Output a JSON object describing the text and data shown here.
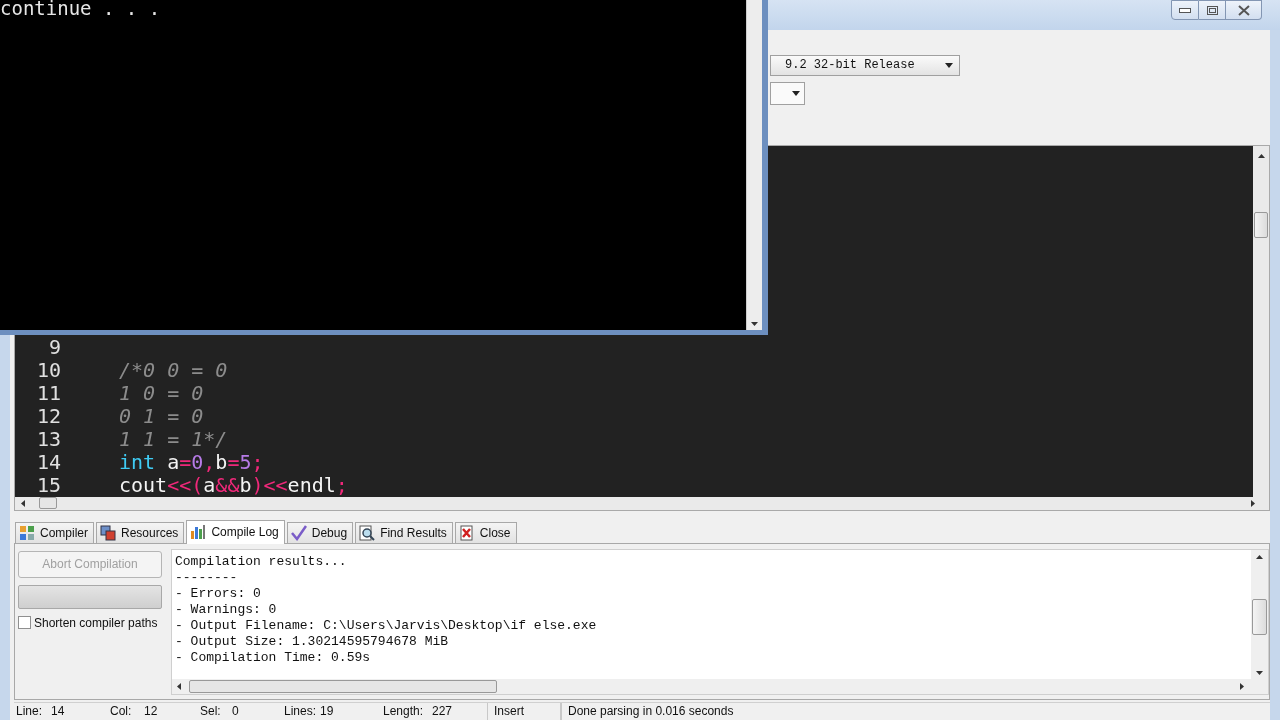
{
  "console": {
    "lines": [
      "continue . . ."
    ]
  },
  "toolbar": {
    "compiler_select": {
      "value": "9.2 32-bit Release"
    }
  },
  "editor": {
    "lines": [
      {
        "number": "9"
      },
      {
        "number": "10",
        "tokens": [
          {
            "kind": "comment",
            "text": "/*0 0 = 0"
          }
        ]
      },
      {
        "number": "11",
        "tokens": [
          {
            "kind": "comment",
            "text": "1 0 = 0"
          }
        ]
      },
      {
        "number": "12",
        "tokens": [
          {
            "kind": "comment",
            "text": "0 1 = 0"
          }
        ]
      },
      {
        "number": "13",
        "tokens": [
          {
            "kind": "comment",
            "text": "1 1 = 1*/"
          }
        ]
      },
      {
        "number": "14",
        "tokens": [
          {
            "kind": "keyword",
            "text": "int"
          },
          {
            "kind": "plain",
            "text": " a"
          },
          {
            "kind": "operator",
            "text": "="
          },
          {
            "kind": "number",
            "text": "0"
          },
          {
            "kind": "operator",
            "text": ","
          },
          {
            "kind": "plain",
            "text": "b"
          },
          {
            "kind": "operator",
            "text": "="
          },
          {
            "kind": "number",
            "text": "5"
          },
          {
            "kind": "operator",
            "text": ";"
          }
        ]
      },
      {
        "number": "15",
        "tokens": [
          {
            "kind": "plain",
            "text": "cout"
          },
          {
            "kind": "operator",
            "text": "<<("
          },
          {
            "kind": "plain",
            "text": "a"
          },
          {
            "kind": "operator",
            "text": "&&"
          },
          {
            "kind": "plain",
            "text": "b"
          },
          {
            "kind": "operator",
            "text": ")<<"
          },
          {
            "kind": "plain",
            "text": "endl"
          },
          {
            "kind": "operator",
            "text": ";"
          }
        ]
      }
    ]
  },
  "bottom_tabs": [
    {
      "label": "Compiler",
      "selected": false
    },
    {
      "label": "Resources",
      "selected": false
    },
    {
      "label": "Compile Log",
      "selected": true
    },
    {
      "label": "Debug",
      "selected": false
    },
    {
      "label": "Find Results",
      "selected": false
    },
    {
      "label": "Close",
      "selected": false
    }
  ],
  "compile_panel": {
    "abort_button": {
      "label": "Abort Compilation",
      "disabled": true
    },
    "progress": {
      "level": 0
    },
    "shorten_paths": {
      "label": "Shorten compiler paths",
      "checked": false
    }
  },
  "compile_log": [
    "Compilation results...",
    "--------",
    "- Errors: 0",
    "- Warnings: 0",
    "- Output Filename: C:\\Users\\Jarvis\\Desktop\\if else.exe",
    "- Output Size: 1.30214595794678 MiB",
    "- Compilation Time: 0.59s"
  ],
  "status_bar": [
    {
      "label": "Line:",
      "value": "14"
    },
    {
      "label": "Col:",
      "value": "12"
    },
    {
      "label": "Sel:",
      "value": "0"
    },
    {
      "label": "Lines:",
      "value": "19"
    },
    {
      "label": "Length:",
      "value": "227"
    },
    {
      "text": "Insert"
    },
    {
      "text": "Done parsing in 0.016 seconds"
    }
  ]
}
